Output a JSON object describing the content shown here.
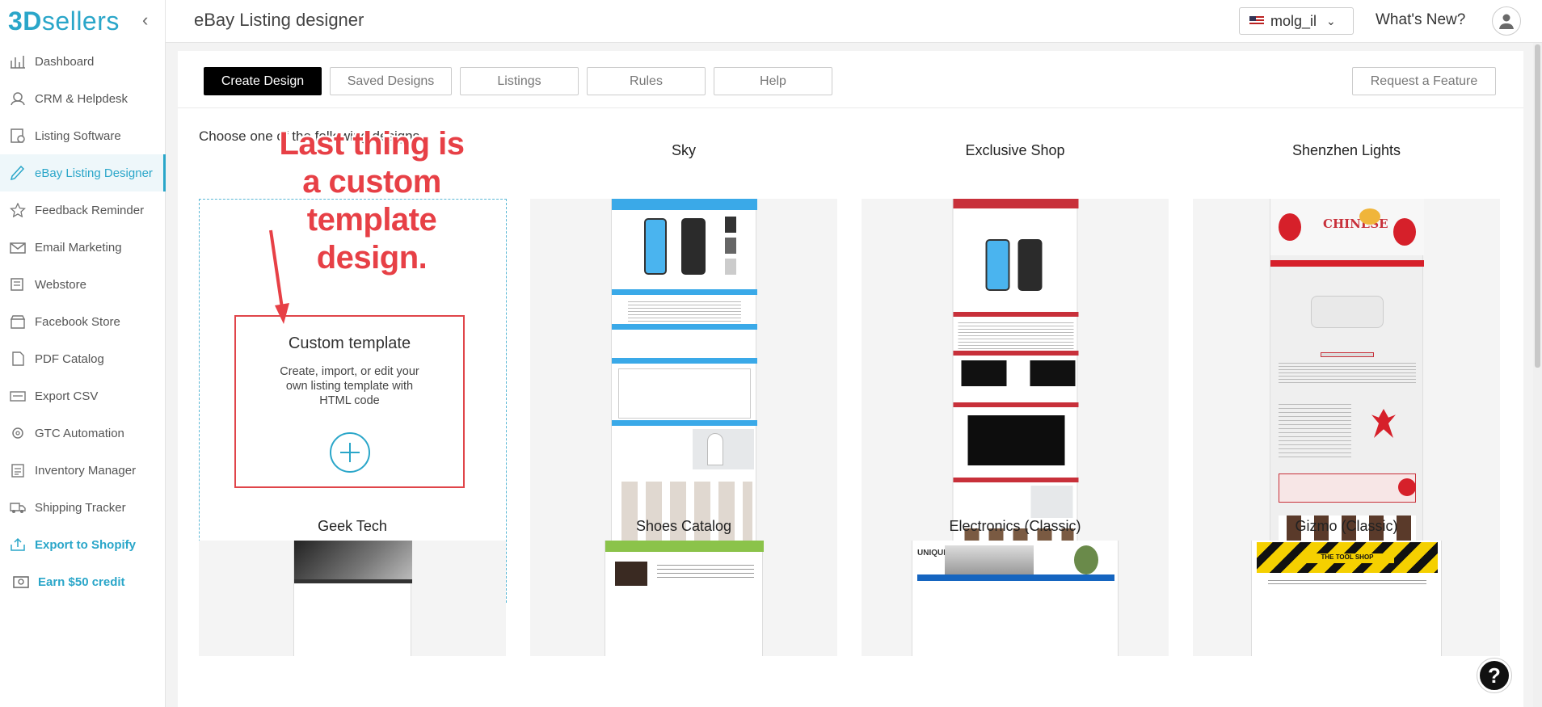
{
  "sidebar": {
    "logo_3d": "3D",
    "logo_sellers": "sellers",
    "items": [
      {
        "label": "Dashboard",
        "icon": "chart-icon"
      },
      {
        "label": "CRM & Helpdesk",
        "icon": "headset-icon"
      },
      {
        "label": "Listing Software",
        "icon": "listing-icon"
      },
      {
        "label": "eBay Listing Designer",
        "icon": "brush-icon"
      },
      {
        "label": "Feedback Reminder",
        "icon": "star-icon"
      },
      {
        "label": "Email Marketing",
        "icon": "envelope-icon"
      },
      {
        "label": "Webstore",
        "icon": "store-icon"
      },
      {
        "label": "Facebook Store",
        "icon": "shop-icon"
      },
      {
        "label": "PDF Catalog",
        "icon": "pdf-icon"
      },
      {
        "label": "Export CSV",
        "icon": "csv-icon"
      },
      {
        "label": "GTC Automation",
        "icon": "gear-icon"
      },
      {
        "label": "Inventory Manager",
        "icon": "clipboard-icon"
      },
      {
        "label": "Shipping Tracker",
        "icon": "truck-icon"
      },
      {
        "label": "Export to Shopify",
        "icon": "export-icon"
      },
      {
        "label": "Earn $50 credit",
        "icon": "wallet-icon"
      }
    ]
  },
  "header": {
    "title": "eBay Listing designer",
    "locale": "molg_il",
    "whats_new": "What's New?"
  },
  "tabs": [
    "Create Design",
    "Saved Designs",
    "Listings",
    "Rules",
    "Help"
  ],
  "request_feature": "Request a Feature",
  "choose_text": "Choose one of the following designs",
  "annotation": "Last thing is a custom template design.",
  "custom_template": {
    "title": "Custom template",
    "description": "Create, import, or edit your own listing template with HTML code"
  },
  "designs_row1": [
    "Sky",
    "Exclusive Shop",
    "Shenzhen Lights"
  ],
  "designs_row2": [
    "Geek Tech",
    "Shoes Catalog",
    "Electronics (Classic)",
    "Gizmo (Classic)"
  ],
  "thumb_text": {
    "chinese_new_year": "CHINESE",
    "tool_shop": "THE TOOL SHOP",
    "unique": "UNIQUE"
  },
  "help_fab": "?",
  "colors": {
    "accent": "#2aa6c9",
    "annotation": "#e74046",
    "sky_blue": "#3aa9e8",
    "exclusive_red": "#c8303a"
  }
}
